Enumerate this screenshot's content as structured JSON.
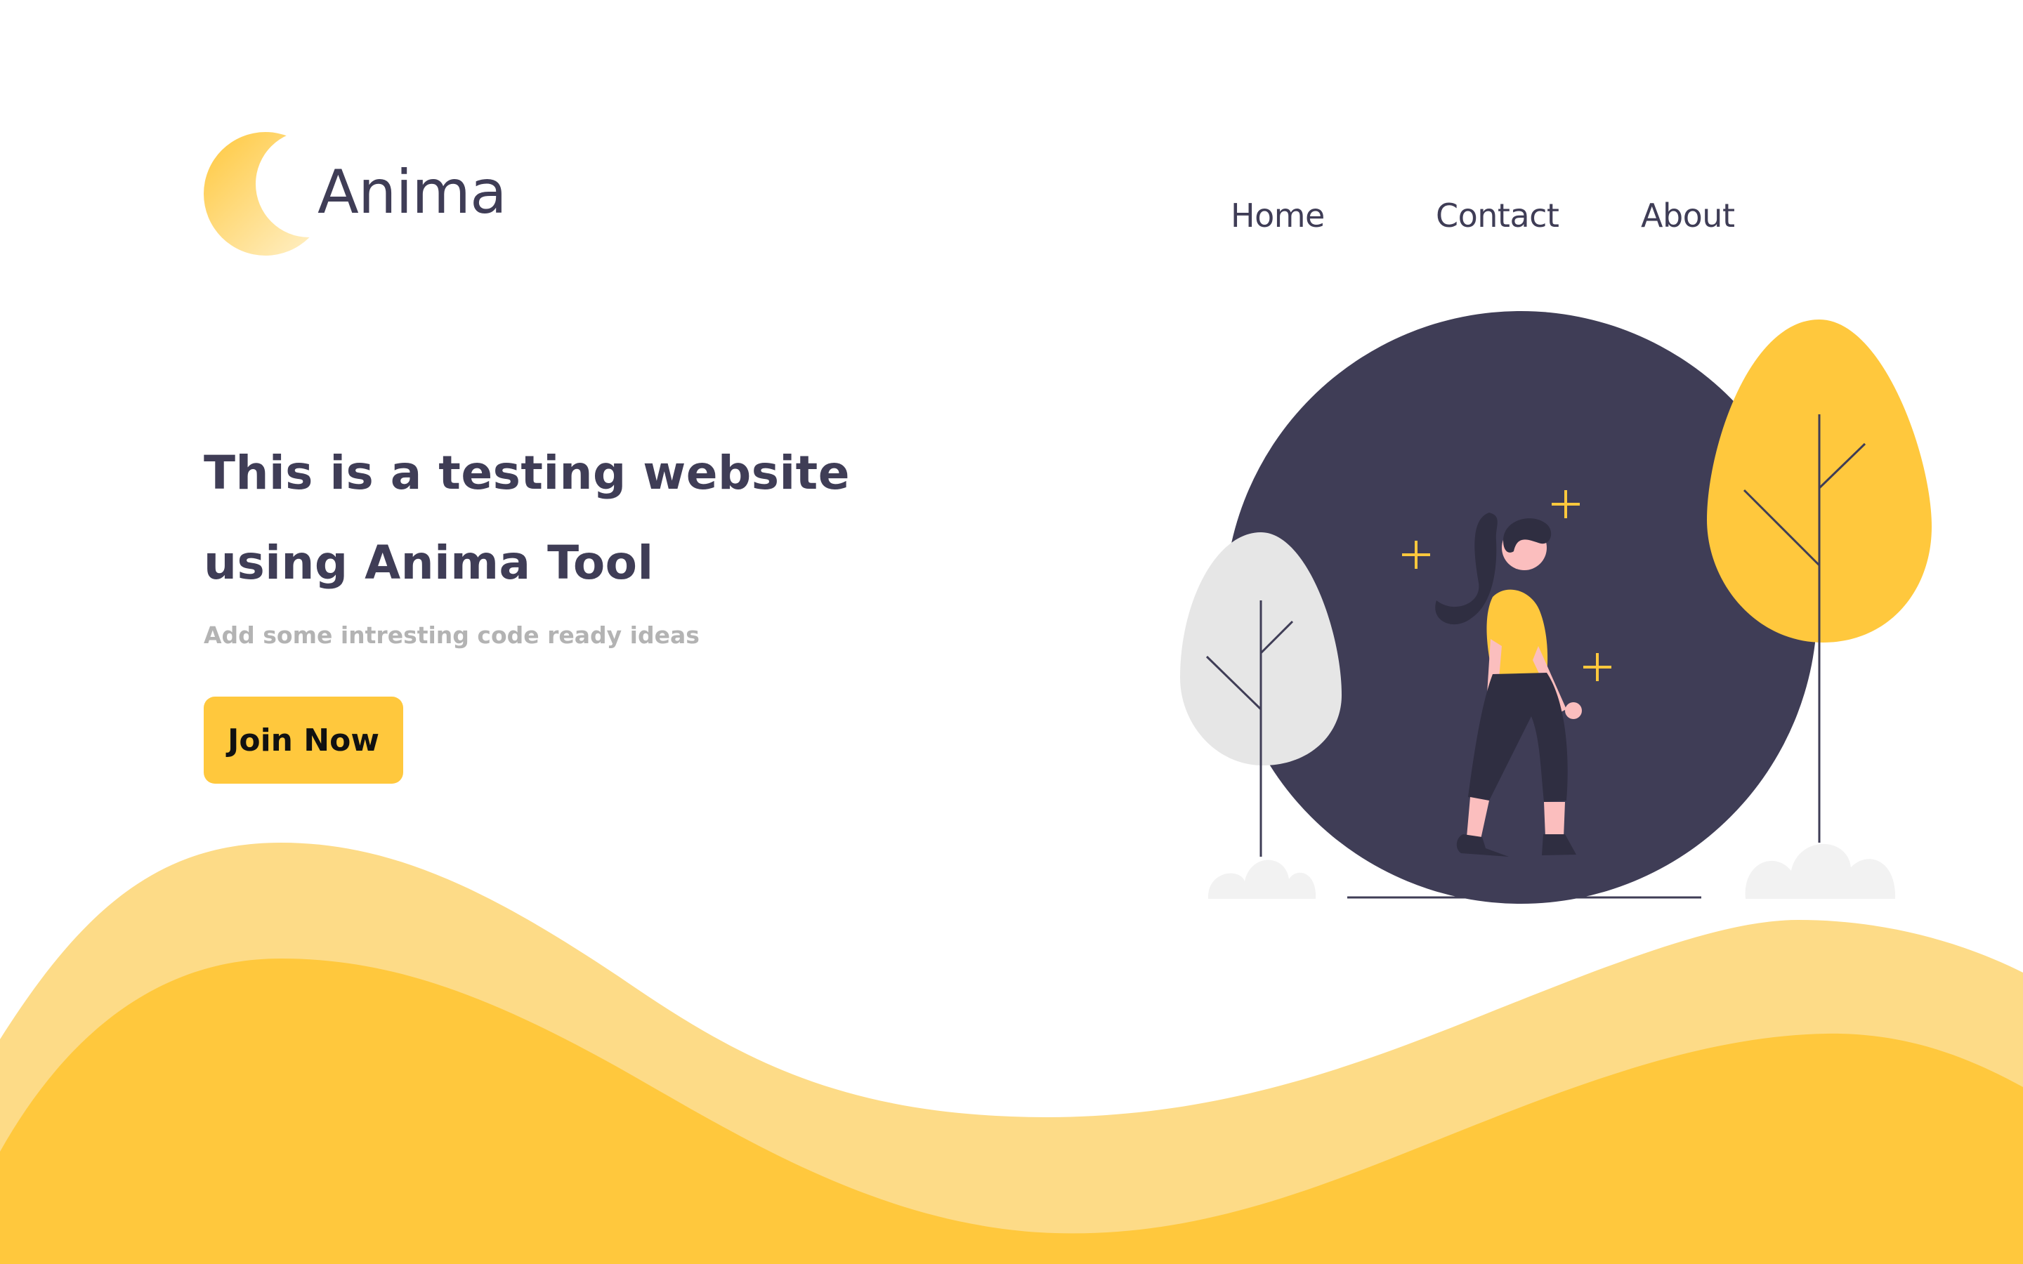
{
  "brand": {
    "name": "Anima",
    "logo_icon": "moon-icon"
  },
  "nav": {
    "items": [
      {
        "label": "Home"
      },
      {
        "label": "Contact"
      },
      {
        "label": "About"
      }
    ]
  },
  "hero": {
    "title_line1": "This is a testing website",
    "title_line2": "using Anima Tool",
    "subtitle": "Add some intresting code ready ideas",
    "cta_label": "Join Now"
  },
  "illustration": {
    "name": "woman-walking-illustration"
  },
  "colors": {
    "accent": "#ffc83d",
    "accent_light": "#fddb87",
    "dark": "#3f3d56",
    "muted": "#b3b3b3",
    "tree_gray": "#e6e6e6"
  }
}
